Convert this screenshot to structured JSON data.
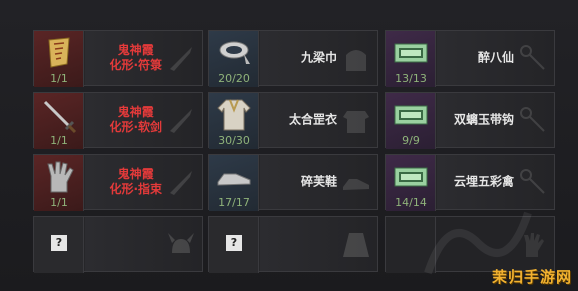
{
  "columns": [
    {
      "rows": [
        {
          "rarity": "red",
          "icon": "talisman-paper-icon",
          "count": "1/1",
          "name_lines": [
            "鬼神霞",
            "化形·符箓"
          ],
          "name_color": "red",
          "ghost": "dagger-silhouette-icon"
        },
        {
          "rarity": "red",
          "icon": "sword-icon",
          "count": "1/1",
          "name_lines": [
            "鬼神霞",
            "化形·软剑"
          ],
          "name_color": "red",
          "ghost": "dagger-silhouette-icon"
        },
        {
          "rarity": "red",
          "icon": "clawed-glove-icon",
          "count": "1/1",
          "name_lines": [
            "鬼神霞",
            "化形·指束"
          ],
          "name_color": "red",
          "ghost": "dagger-silhouette-icon"
        },
        {
          "rarity": "empty",
          "icon": "unknown-icon",
          "qmark": "?",
          "count": "",
          "name_lines": [],
          "name_color": "white",
          "ghost": "horned-helmet-silhouette-icon"
        }
      ]
    },
    {
      "rows": [
        {
          "rarity": "blue",
          "icon": "headband-icon",
          "count": "20/20",
          "name_lines": [
            "九梁巾"
          ],
          "name_color": "white",
          "ghost": "hood-silhouette-icon"
        },
        {
          "rarity": "blue",
          "icon": "robe-icon",
          "count": "30/30",
          "name_lines": [
            "太合罡衣"
          ],
          "name_color": "white",
          "ghost": "armor-silhouette-icon"
        },
        {
          "rarity": "blue",
          "icon": "cloth-shoe-icon",
          "count": "17/17",
          "name_lines": [
            "碎芙鞋"
          ],
          "name_color": "white",
          "ghost": "shoe-silhouette-icon"
        },
        {
          "rarity": "empty",
          "icon": "unknown-icon",
          "qmark": "?",
          "count": "",
          "name_lines": [],
          "name_color": "white",
          "ghost": "cape-silhouette-icon"
        }
      ]
    },
    {
      "rows": [
        {
          "rarity": "purple",
          "icon": "jade-belt-icon",
          "count": "13/13",
          "name_lines": [
            "醉八仙"
          ],
          "name_color": "white",
          "ghost": "chain-silhouette-icon"
        },
        {
          "rarity": "purple",
          "icon": "jade-belt-icon",
          "count": "9/9",
          "name_lines": [
            "双螭玉带钩"
          ],
          "name_color": "white",
          "ghost": "chain-silhouette-icon"
        },
        {
          "rarity": "purple",
          "icon": "jade-belt-icon",
          "count": "14/14",
          "name_lines": [
            "云埋五彩禽"
          ],
          "name_color": "white",
          "ghost": "chain-silhouette-icon"
        },
        {
          "rarity": "empty",
          "icon": "",
          "count": "",
          "name_lines": [],
          "name_color": "white",
          "ghost": "hand-silhouette-icon"
        }
      ]
    }
  ],
  "watermark": "茉归手游网",
  "colors": {
    "red_name": "#e33a3a",
    "count_green": "#8fb37a",
    "watermark": "#f2b230"
  }
}
